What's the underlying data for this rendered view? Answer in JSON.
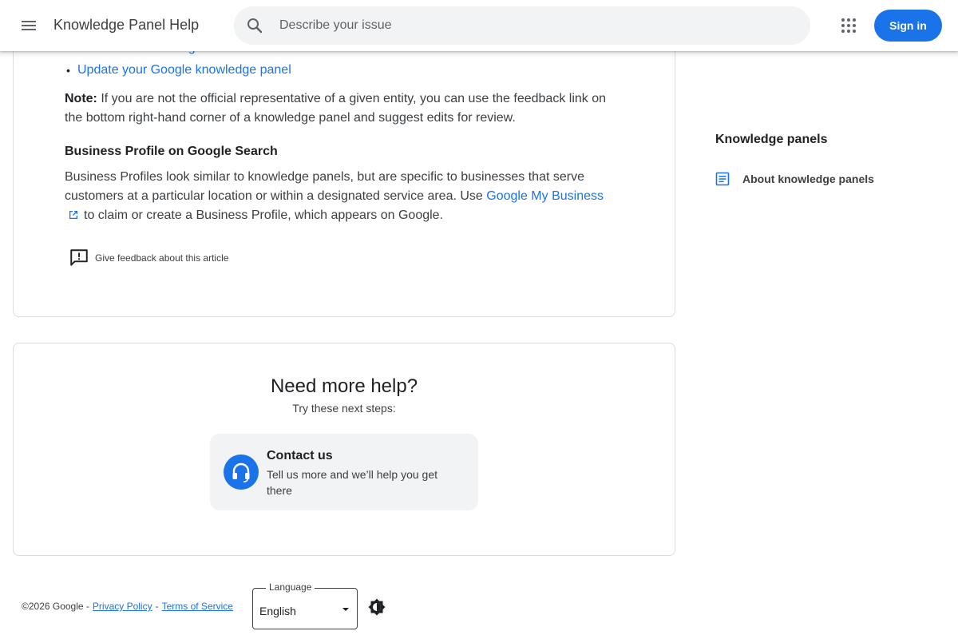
{
  "header": {
    "app_title": "Knowledge Panel Help",
    "search_placeholder": "Describe your issue",
    "signin_label": "Sign in"
  },
  "article": {
    "bullets": [
      {
        "label": "Get verified on Google"
      },
      {
        "label": "Update your Google knowledge panel"
      }
    ],
    "note_label": "Note:",
    "note_text": " If you are not the official representative of a given entity, you can use the feedback link on the bottom right-hand corner of a knowledge panel and suggest edits for review.",
    "section_heading": "Business Profile on Google Search",
    "para_before": "Business Profiles look similar to knowledge panels, but are specific to businesses that serve customers at a particular location or within a designated service area. Use ",
    "para_link": "Google My Business",
    "para_after": "to claim or create a Business Profile, which appears on Google.",
    "feedback_label": "Give feedback about this article"
  },
  "help": {
    "title": "Need more help?",
    "subtitle": "Try these next steps:",
    "contact_title": "Contact us",
    "contact_desc": "Tell us more and we’ll help you get there"
  },
  "sidebar": {
    "heading": "Knowledge panels",
    "items": [
      {
        "label": "About knowledge panels"
      }
    ]
  },
  "footer": {
    "copyright": "©2026 Google -",
    "privacy": "Privacy Policy",
    "separator": "-",
    "terms": "Terms of Service",
    "language_label": "Language",
    "language_value": "English"
  },
  "colors": {
    "accent": "#1a73e8",
    "text": "#202124",
    "secondary_text": "#3c4043"
  }
}
